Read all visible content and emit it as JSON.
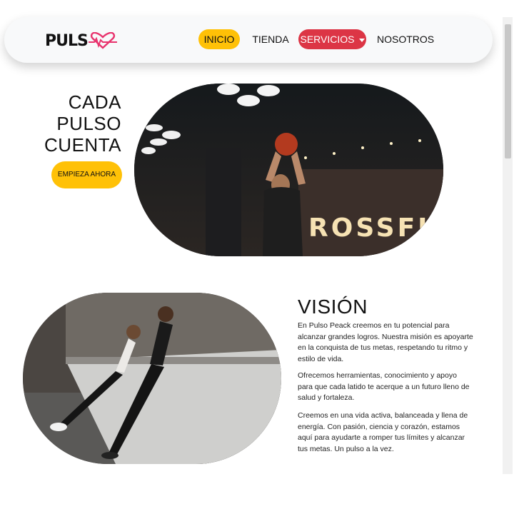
{
  "brand": {
    "logo_text": "PULS",
    "accent_pink": "#e8336d",
    "accent_yellow": "#ffc107",
    "accent_red": "#dc3545"
  },
  "nav": {
    "items": [
      {
        "label": "INICIO",
        "state": "active"
      },
      {
        "label": "TIENDA",
        "state": "default"
      },
      {
        "label": "SERVICIOS",
        "state": "dropdown"
      },
      {
        "label": "NOSOTROS",
        "state": "default"
      }
    ]
  },
  "hero": {
    "title_lines": [
      "CADA",
      "PULSO",
      "CUENTA"
    ],
    "cta_label": "EMPIEZA AHORA",
    "image_sign_text": "ROSSFI"
  },
  "vision": {
    "title": "VISIÓN",
    "paragraphs": [
      "En Pulso Peack creemos en tu potencial para alcanzar grandes logros. Nuestra misión es apoyarte en la conquista de tus metas, respetando tu ritmo y estilo de vida.",
      "Ofrecemos herramientas, conocimiento y apoyo para que cada latido te acerque a un futuro lleno de salud y fortaleza.",
      "Creemos en una vida activa, balanceada y llena de energía. Con pasión, ciencia y corazón, estamos aquí para ayudarte a romper tus límites y alcanzar tus metas. Un pulso a la vez."
    ]
  }
}
